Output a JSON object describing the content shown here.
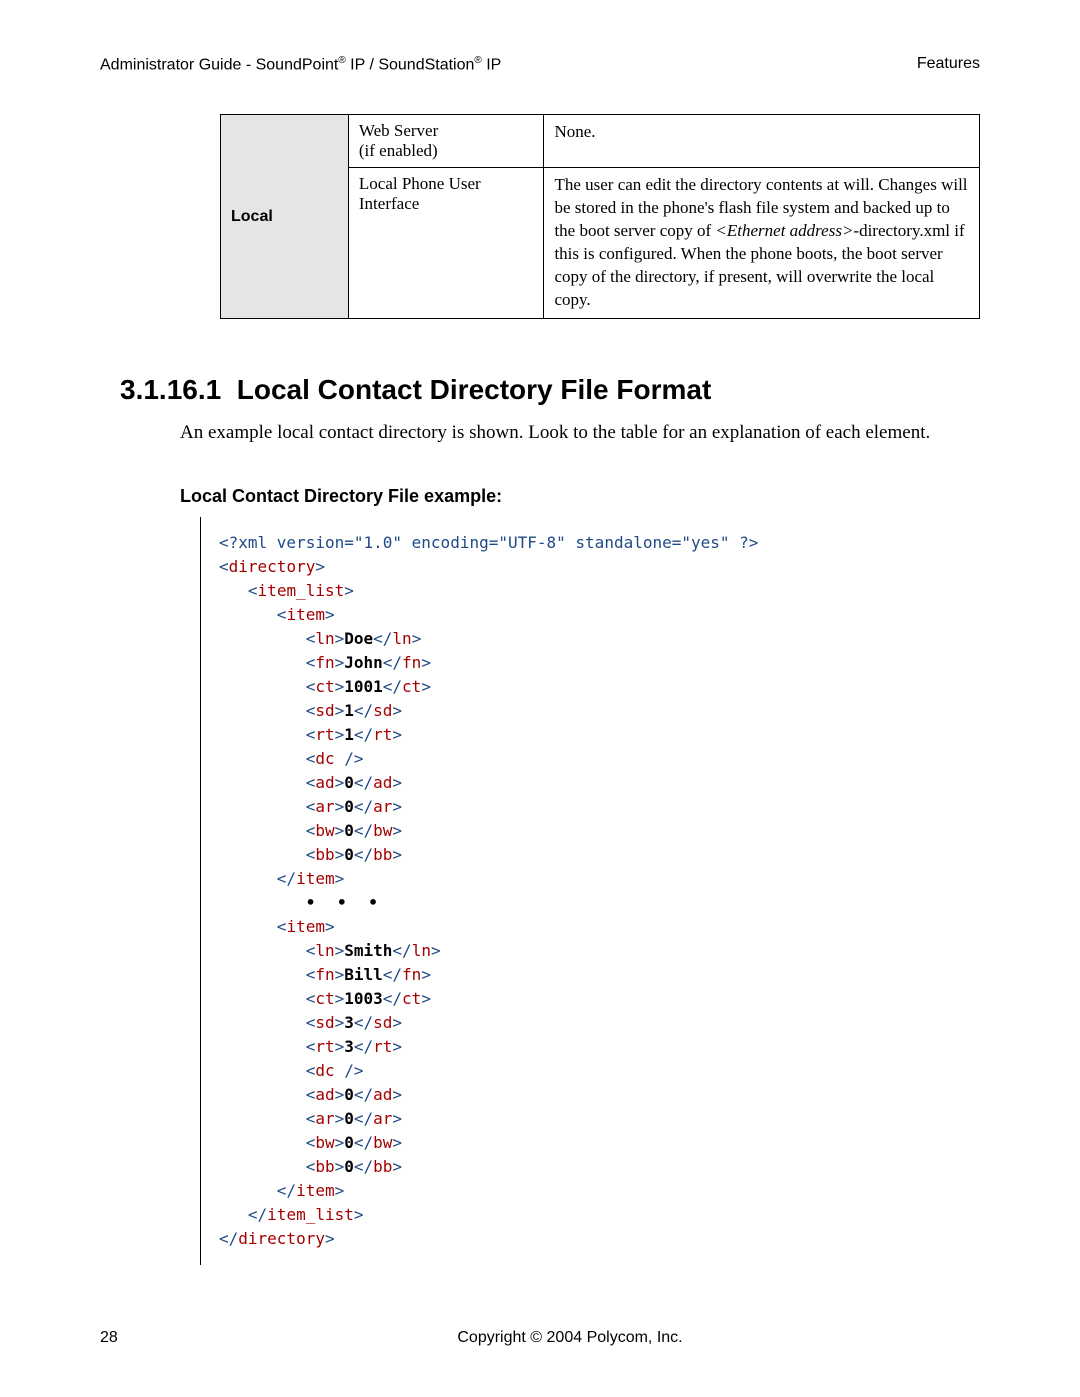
{
  "header": {
    "left": "Administrator Guide - SoundPoint® IP / SoundStation® IP",
    "right": "Features"
  },
  "table": {
    "rowLabel": "Local",
    "rows": [
      {
        "c2a": "Web Server",
        "c2b": "(if enabled)",
        "c3": "None."
      },
      {
        "c2a": "Local Phone User",
        "c2b": "Interface",
        "c3_part1": "The user can edit the directory contents at will.  Changes will be stored in the phone's flash file system and backed up to the boot server copy of ",
        "c3_em": "<Ethernet address>",
        "c3_part2": "-directory.xml if this is configured.  When the phone boots, the boot server copy of the directory, if present, will overwrite the local copy."
      }
    ]
  },
  "section": {
    "number": "3.1.16.1",
    "title": "Local Contact Directory File Format",
    "intro": "An example local contact directory is shown.  Look to the table for an explanation of each element.",
    "subheading": "Local Contact Directory File example:"
  },
  "code": {
    "xmlDecl": "<?xml version=\"1.0\" encoding=\"UTF-8\" standalone=\"yes\" ?>",
    "directoryOpen": "directory",
    "itemListOpen": "item_list",
    "itemOpen": "item",
    "entries": [
      {
        "ln": "Doe",
        "fn": "John",
        "ct": "1001",
        "sd": "1",
        "rt": "1",
        "ad": "0",
        "ar": "0",
        "bw": "0",
        "bb": "0"
      },
      {
        "ln": "Smith",
        "fn": "Bill",
        "ct": "1003",
        "sd": "3",
        "rt": "3",
        "ad": "0",
        "ar": "0",
        "bw": "0",
        "bb": "0"
      }
    ],
    "ellipsis": "• • •"
  },
  "footer": {
    "page": "28",
    "copyright": "Copyright © 2004 Polycom, Inc."
  }
}
